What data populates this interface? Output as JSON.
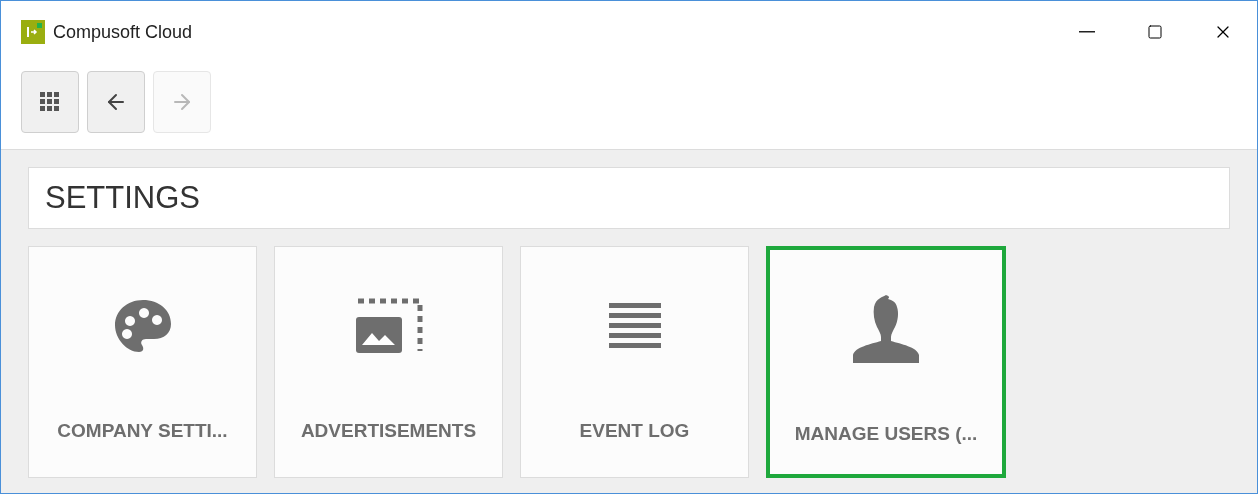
{
  "window": {
    "title": "Compusoft Cloud"
  },
  "toolbar": [
    {
      "kind": "apps",
      "disabled": false
    },
    {
      "kind": "back",
      "disabled": false
    },
    {
      "kind": "forward",
      "disabled": true
    }
  ],
  "page": {
    "title": "SETTINGS"
  },
  "tiles": [
    {
      "kind": "palette",
      "label": "COMPANY SETTI...",
      "selected": false
    },
    {
      "kind": "image",
      "label": "ADVERTISEMENTS",
      "selected": false
    },
    {
      "kind": "list",
      "label": "EVENT LOG",
      "selected": false
    },
    {
      "kind": "user",
      "label": "MANAGE USERS (...",
      "selected": true
    }
  ]
}
